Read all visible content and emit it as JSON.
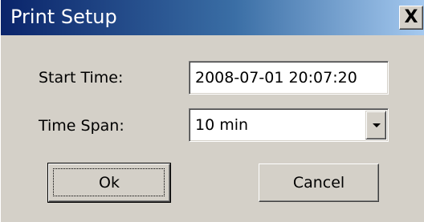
{
  "dialog": {
    "title": "Print Setup",
    "close_glyph": "X"
  },
  "form": {
    "start_time": {
      "label": "Start Time:",
      "value": "2008-07-01 20:07:20"
    },
    "time_span": {
      "label": "Time Span:",
      "selected": "10 min",
      "dropdown_icon": "chevron-down-icon"
    }
  },
  "buttons": {
    "ok_label": "Ok",
    "cancel_label": "Cancel"
  },
  "colors": {
    "title_bar_start": "#0a246a",
    "title_bar_end": "#a6caf0",
    "dialog_face": "#d4d0c8"
  }
}
